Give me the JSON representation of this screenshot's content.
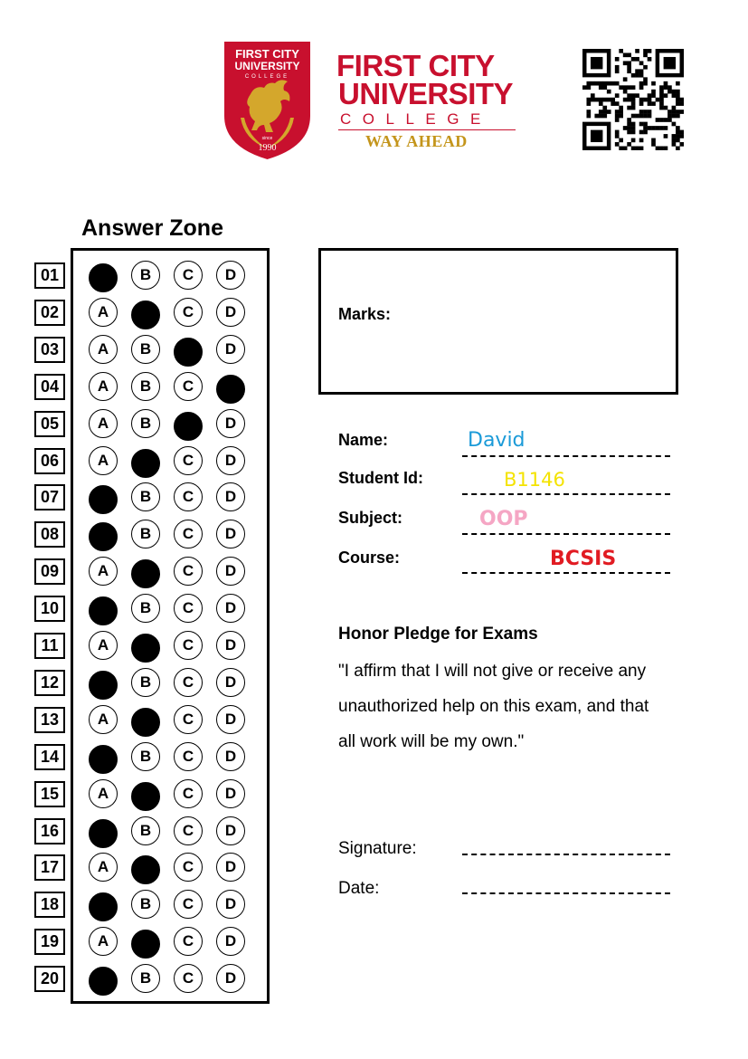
{
  "header": {
    "crest": {
      "text_lines": [
        "FIRST CITY",
        "UNIVERSITY",
        "COLLEGE"
      ],
      "since": "since",
      "year": "1990",
      "colors": {
        "shield": "#c8102e",
        "gold": "#d4a72c"
      }
    },
    "wordmark": {
      "line1": "FIRST CITY",
      "line2": "UNIVERSITY",
      "line3": "COLLEGE",
      "slogan": "WAY AHEAD",
      "colors": {
        "primary": "#c8102e",
        "slogan": "#c4951b"
      }
    },
    "qr_icon": "qr-code-icon"
  },
  "answer_zone": {
    "title": "Answer Zone",
    "option_labels": [
      "A",
      "B",
      "C",
      "D"
    ],
    "questions": [
      {
        "num": "01",
        "answer": "A"
      },
      {
        "num": "02",
        "answer": "B"
      },
      {
        "num": "03",
        "answer": "C"
      },
      {
        "num": "04",
        "answer": "D"
      },
      {
        "num": "05",
        "answer": "C"
      },
      {
        "num": "06",
        "answer": "B"
      },
      {
        "num": "07",
        "answer": "A"
      },
      {
        "num": "08",
        "answer": "A"
      },
      {
        "num": "09",
        "answer": "B"
      },
      {
        "num": "10",
        "answer": "A"
      },
      {
        "num": "11",
        "answer": "B"
      },
      {
        "num": "12",
        "answer": "A"
      },
      {
        "num": "13",
        "answer": "B"
      },
      {
        "num": "14",
        "answer": "A"
      },
      {
        "num": "15",
        "answer": "B"
      },
      {
        "num": "16",
        "answer": "A"
      },
      {
        "num": "17",
        "answer": "B"
      },
      {
        "num": "18",
        "answer": "A"
      },
      {
        "num": "19",
        "answer": "B"
      },
      {
        "num": "20",
        "answer": "A"
      }
    ]
  },
  "marks": {
    "label": "Marks:"
  },
  "student": {
    "name_label": "Name:",
    "name_value": "David",
    "id_label": "Student Id:",
    "id_value": "B1146",
    "subject_label": "Subject:",
    "subject_value": "OOP",
    "course_label": "Course:",
    "course_value": "BCSIS",
    "colors": {
      "name": "#1a9ad8",
      "id": "#f4e300",
      "subject": "#f5a6c4",
      "course": "#e11b22"
    }
  },
  "pledge": {
    "title": "Honor Pledge for Exams",
    "lines": [
      "\"I affirm that I will not give or receive any",
      "unauthorized help on this exam, and that",
      "all work will be my own.\""
    ]
  },
  "signature": {
    "signature_label": "Signature:",
    "date_label": "Date:"
  }
}
